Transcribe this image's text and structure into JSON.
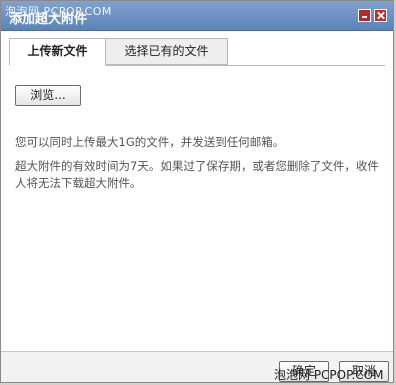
{
  "window": {
    "title": "添加超大附件",
    "watermark_top": "泡泡网 PCPOP.COM",
    "watermark_bottom": "泡泡网 PCPOP.COM",
    "minimize_icon": "minimize-icon",
    "close_icon": "close-icon"
  },
  "tabs": [
    {
      "label": "上传新文件",
      "active": true
    },
    {
      "label": "选择已有的文件",
      "active": false
    }
  ],
  "upload": {
    "browse_label": "浏览..."
  },
  "info": {
    "line1": "您可以同时上传最大1G的文件，并发送到任何邮箱。",
    "line2": "超大附件的有效时间为7天。如果过了保存期，或者您删除了文件，收件人将无法下载超大附件。"
  },
  "footer": {
    "ok_label": "确定",
    "cancel_label": "取消"
  },
  "colors": {
    "titlebar": "#5b83b8",
    "window_button": "#c8282a"
  }
}
